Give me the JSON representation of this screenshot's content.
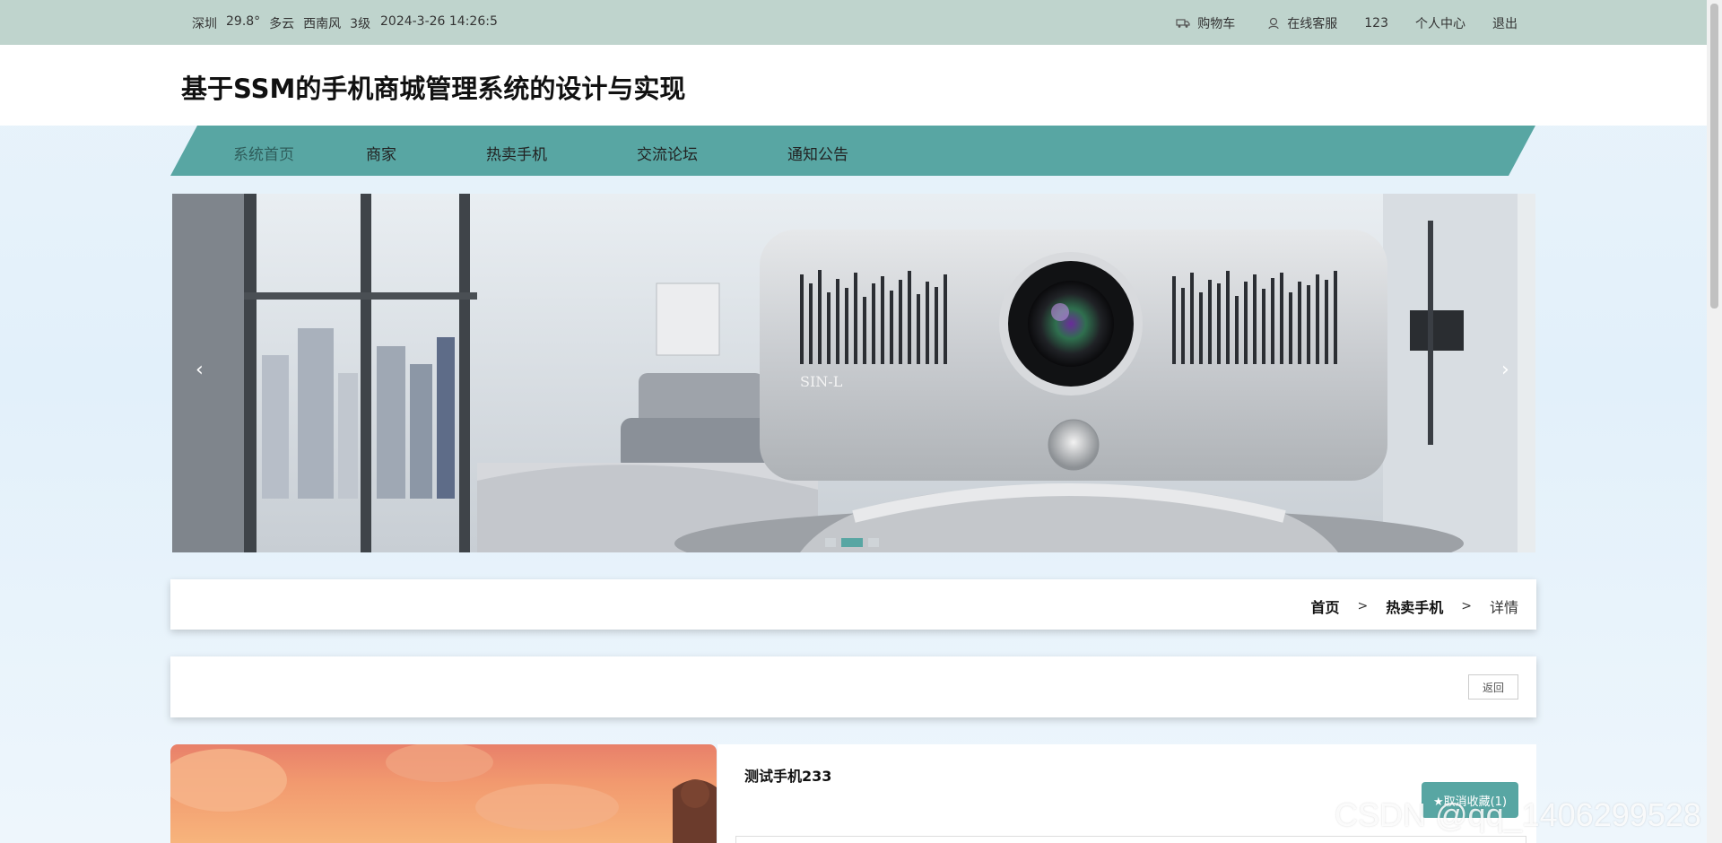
{
  "topbar": {
    "city": "深圳",
    "temperature": "29.8°",
    "weather": "多云",
    "wind": "西南风",
    "wind_level": "3级",
    "datetime": "2024-3-26 14:26:5",
    "cart_label": "购物车",
    "service_label": "在线客服",
    "username": "123",
    "profile_label": "个人中心",
    "logout_label": "退出"
  },
  "header": {
    "title": "基于SSM的手机商城管理系统的设计与实现"
  },
  "nav": {
    "items": [
      {
        "label": "系统首页"
      },
      {
        "label": "商家"
      },
      {
        "label": "热卖手机"
      },
      {
        "label": "交流论坛"
      },
      {
        "label": "通知公告"
      }
    ]
  },
  "banner": {
    "prev_label": "‹",
    "next_label": "›",
    "slide_count": 3,
    "active_slide": 2,
    "product_mark": "SIN-L"
  },
  "breadcrumb": {
    "home": "首页",
    "section": "热卖手机",
    "current": "详情",
    "separator": ">"
  },
  "actions": {
    "back_label": "返回"
  },
  "product": {
    "name": "测试手机233",
    "favorite_label": "★取消收藏(1)"
  },
  "watermark": "CSDN @qq_1406299528",
  "colors": {
    "accent": "#58a6a3",
    "topbar_bg": "#bfd4cd"
  }
}
